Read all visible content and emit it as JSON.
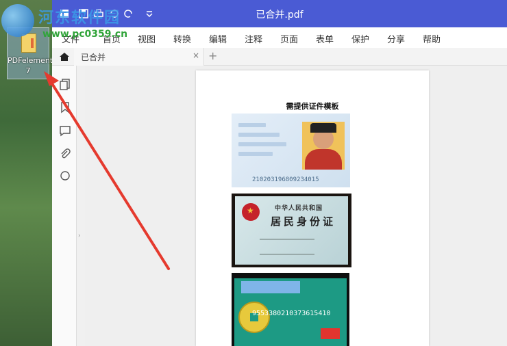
{
  "watermark": {
    "title": "河东软件园",
    "url": "www.pc0359.cn"
  },
  "desktop": {
    "icon_label": "PDFelement 7"
  },
  "window": {
    "title": "已合并.pdf"
  },
  "menu": {
    "items": [
      "文件",
      "首页",
      "视图",
      "转换",
      "编辑",
      "注释",
      "页面",
      "表单",
      "保护",
      "分享",
      "帮助"
    ]
  },
  "tabs": {
    "active_label": "已合并",
    "close_glyph": "×",
    "add_glyph": "+"
  },
  "document": {
    "heading": "需提供证件模板",
    "id_card_number": "210203196809234015",
    "id_card_back_line1": "中华人民共和国",
    "id_card_back_line2": "居民身份证",
    "bank_card_number": "9553380210373615410"
  },
  "colors": {
    "titlebar": "#4a5bd4",
    "annotation_arrow": "#e53a2e"
  },
  "icons": {
    "sidebar": [
      "pages-icon",
      "bookmark-icon",
      "comment-icon",
      "attachment-icon",
      "search-icon"
    ]
  }
}
